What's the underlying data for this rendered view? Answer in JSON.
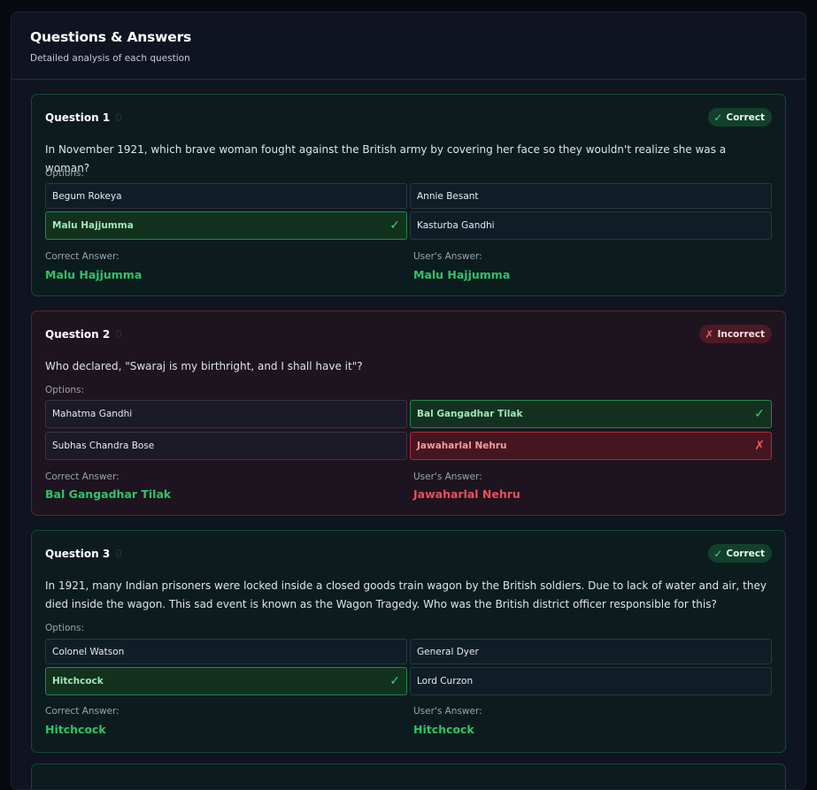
{
  "header": {
    "title": "Questions & Answers",
    "subtitle": "Detailed analysis of each question"
  },
  "labels": {
    "options": "Options:",
    "correct_answer": "Correct Answer:",
    "user_answer": "User's Answer:"
  },
  "status_colors": {
    "correct": "#3bd57b",
    "incorrect": "#f25b67"
  },
  "questions": [
    {
      "title": "Question 1",
      "number_mark": "0",
      "status": "Correct",
      "status_icon": "✓",
      "text": "In November 1921, which brave woman fought against the British army by covering her face so they wouldn't realize she was a woman?",
      "options": [
        "Begum Rokeya",
        "Annie Besant",
        "Malu Hajjumma",
        "Kasturba Gandhi"
      ],
      "option_marks": [
        "",
        "",
        "✓",
        ""
      ],
      "correct_answer": "Malu Hajjumma",
      "user_answer": "Malu Hajjumma"
    },
    {
      "title": "Question 2",
      "number_mark": "0",
      "status": "Incorrect",
      "status_icon": "✗",
      "text": "Who declared, \"Swaraj is my birthright, and I shall have it\"?",
      "options": [
        "Mahatma Gandhi",
        "Bal Gangadhar Tilak",
        "Subhas Chandra Bose",
        "Jawaharlal Nehru"
      ],
      "option_marks": [
        "",
        "✓",
        "",
        "✗"
      ],
      "correct_answer": "Bal Gangadhar Tilak",
      "user_answer": "Jawaharlal Nehru"
    },
    {
      "title": "Question 3",
      "number_mark": "0",
      "status": "Correct",
      "status_icon": "✓",
      "text": "In 1921, many Indian prisoners were locked inside a closed goods train wagon by the British soldiers. Due to lack of water and air, they died inside the wagon. This sad event is known as the Wagon Tragedy. Who was the British district officer responsible for this?",
      "options": [
        "Colonel Watson",
        "General Dyer",
        "Hitchcock",
        "Lord Curzon"
      ],
      "option_marks": [
        "",
        "",
        "✓",
        ""
      ],
      "correct_answer": "Hitchcock",
      "user_answer": "Hitchcock"
    }
  ]
}
